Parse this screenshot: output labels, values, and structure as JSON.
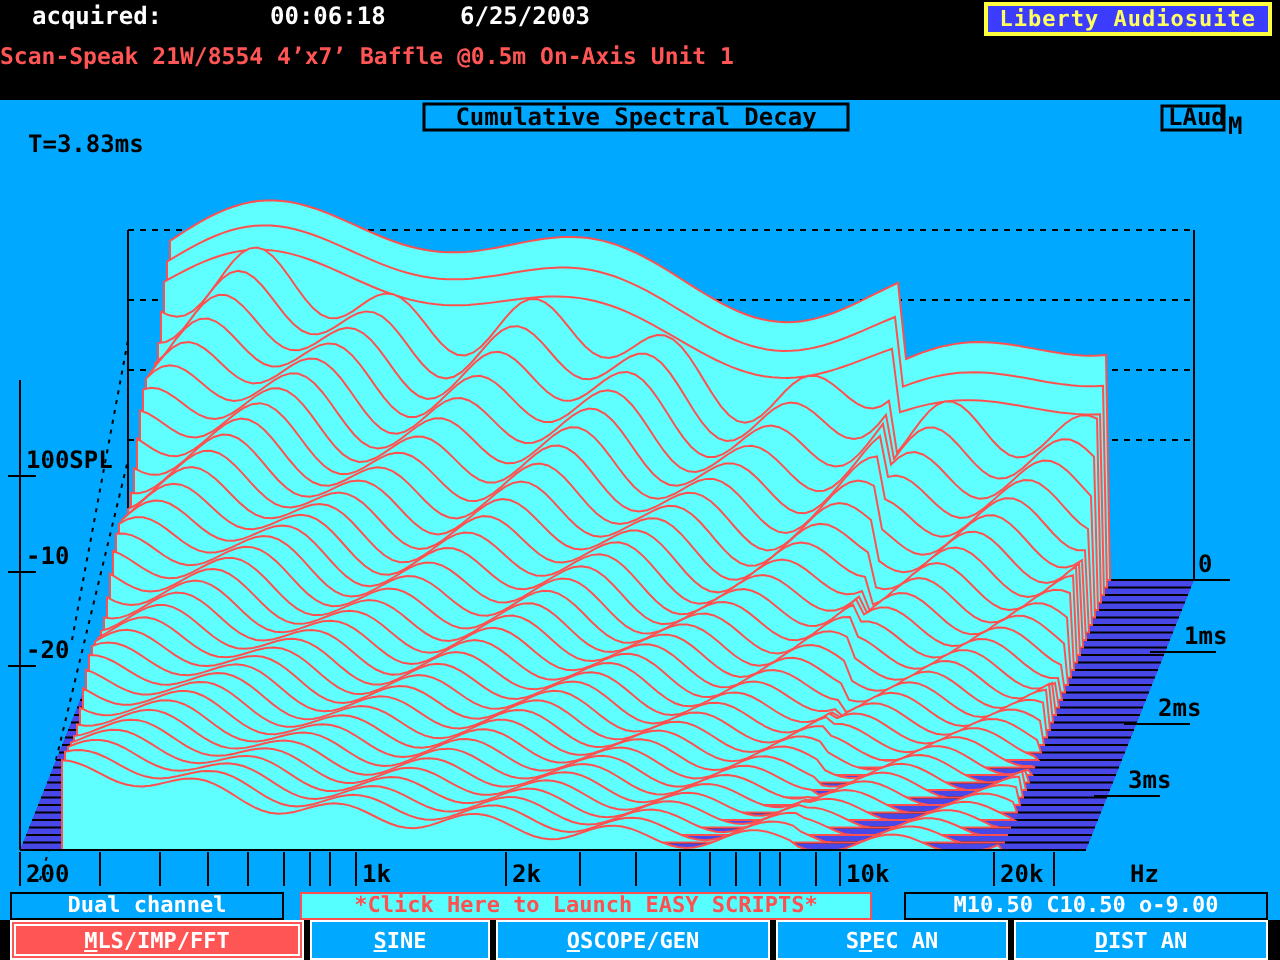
{
  "header": {
    "acquired_label": "acquired:",
    "time": "00:06:18",
    "date": "6/25/2003",
    "app_badge": "Liberty Audiosuite",
    "measurement_title": "Scan-Speak 21W/8554 4’x7’ Baffle @0.5m On-Axis Unit 1"
  },
  "plot": {
    "title": "Cumulative Spectral Decay",
    "logo": "LAud",
    "logo_suffix": "M",
    "time_readout": "T=3.83ms",
    "level_labels": [
      "100SPL",
      "-10",
      "-20"
    ],
    "time_labels": [
      "0",
      "1ms",
      "2ms",
      "3ms"
    ],
    "freq_labels": [
      "200",
      "1k",
      "2k",
      "10k",
      "20k"
    ],
    "freq_unit": "Hz"
  },
  "status": {
    "channel_mode": "Dual channel",
    "scripts_link": "*Click Here to Launch EASY SCRIPTS*",
    "readout": "M10.50 C10.50 o-9.00"
  },
  "modes": [
    {
      "key": "M",
      "after": "LS/IMP/FFT",
      "selected": true
    },
    {
      "key": "S",
      "after": "INE",
      "selected": false
    },
    {
      "key": "O",
      "after": "SCOPE/GEN",
      "selected": false
    },
    {
      "before": "S",
      "key": "P",
      "after": "EC AN",
      "selected": false
    },
    {
      "key": "D",
      "after": "IST AN",
      "selected": false
    }
  ]
}
